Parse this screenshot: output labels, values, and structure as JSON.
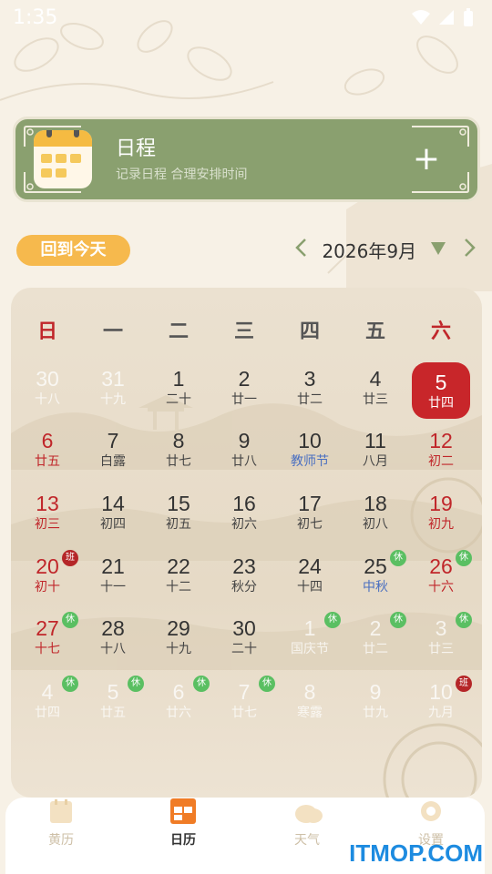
{
  "status_bar": {
    "time": "1:35"
  },
  "schedule": {
    "title": "日程",
    "subtitle": "记录日程 合理安排时间",
    "add_icon": "plus-icon"
  },
  "controls": {
    "today_button": "回到今天",
    "month_label": "2026年9月"
  },
  "weekdays": [
    "日",
    "一",
    "二",
    "三",
    "四",
    "五",
    "六"
  ],
  "weeks": [
    [
      {
        "d": "30",
        "l": "十八",
        "faded": true
      },
      {
        "d": "31",
        "l": "十九",
        "faded": true
      },
      {
        "d": "1",
        "l": "二十"
      },
      {
        "d": "2",
        "l": "廿一"
      },
      {
        "d": "3",
        "l": "廿二"
      },
      {
        "d": "4",
        "l": "廿三"
      },
      {
        "d": "5",
        "l": "廿四",
        "today": true
      }
    ],
    [
      {
        "d": "6",
        "l": "廿五",
        "red": true
      },
      {
        "d": "7",
        "l": "白露"
      },
      {
        "d": "8",
        "l": "廿七"
      },
      {
        "d": "9",
        "l": "廿八"
      },
      {
        "d": "10",
        "l": "教师节",
        "fest": true
      },
      {
        "d": "11",
        "l": "八月"
      },
      {
        "d": "12",
        "l": "初二",
        "red": true
      }
    ],
    [
      {
        "d": "13",
        "l": "初三",
        "red": true
      },
      {
        "d": "14",
        "l": "初四"
      },
      {
        "d": "15",
        "l": "初五"
      },
      {
        "d": "16",
        "l": "初六"
      },
      {
        "d": "17",
        "l": "初七"
      },
      {
        "d": "18",
        "l": "初八"
      },
      {
        "d": "19",
        "l": "初九",
        "red": true
      }
    ],
    [
      {
        "d": "20",
        "l": "初十",
        "red": true,
        "badge": "班"
      },
      {
        "d": "21",
        "l": "十一"
      },
      {
        "d": "22",
        "l": "十二"
      },
      {
        "d": "23",
        "l": "秋分"
      },
      {
        "d": "24",
        "l": "十四"
      },
      {
        "d": "25",
        "l": "中秋",
        "fest": true,
        "badge": "休"
      },
      {
        "d": "26",
        "l": "十六",
        "red": true,
        "badge": "休"
      }
    ],
    [
      {
        "d": "27",
        "l": "十七",
        "red": true,
        "badge": "休"
      },
      {
        "d": "28",
        "l": "十八"
      },
      {
        "d": "29",
        "l": "十九"
      },
      {
        "d": "30",
        "l": "二十"
      },
      {
        "d": "1",
        "l": "国庆节",
        "faded": true,
        "badge": "休"
      },
      {
        "d": "2",
        "l": "廿二",
        "faded": true,
        "badge": "休"
      },
      {
        "d": "3",
        "l": "廿三",
        "faded": true,
        "badge": "休"
      }
    ],
    [
      {
        "d": "4",
        "l": "廿四",
        "faded": true,
        "badge": "休"
      },
      {
        "d": "5",
        "l": "廿五",
        "faded": true,
        "badge": "休"
      },
      {
        "d": "6",
        "l": "廿六",
        "faded": true,
        "badge": "休"
      },
      {
        "d": "7",
        "l": "廿七",
        "faded": true,
        "badge": "休"
      },
      {
        "d": "8",
        "l": "寒露",
        "faded": true
      },
      {
        "d": "9",
        "l": "廿九",
        "faded": true
      },
      {
        "d": "10",
        "l": "九月",
        "faded": true,
        "badge": "班"
      }
    ]
  ],
  "tabs": [
    {
      "label": "黄历",
      "icon": "almanac-icon"
    },
    {
      "label": "日历",
      "icon": "calendar-grid-icon",
      "active": true
    },
    {
      "label": "天气",
      "icon": "cloud-icon"
    },
    {
      "label": "设置",
      "icon": "gear-icon"
    }
  ],
  "watermark": "ITMOP.COM",
  "colors": {
    "accent_green": "#8aa06f",
    "today_red": "#c8262a",
    "holiday_badge": "#5abf62",
    "workday_badge": "#b52628",
    "button_orange": "#f6b94d"
  }
}
